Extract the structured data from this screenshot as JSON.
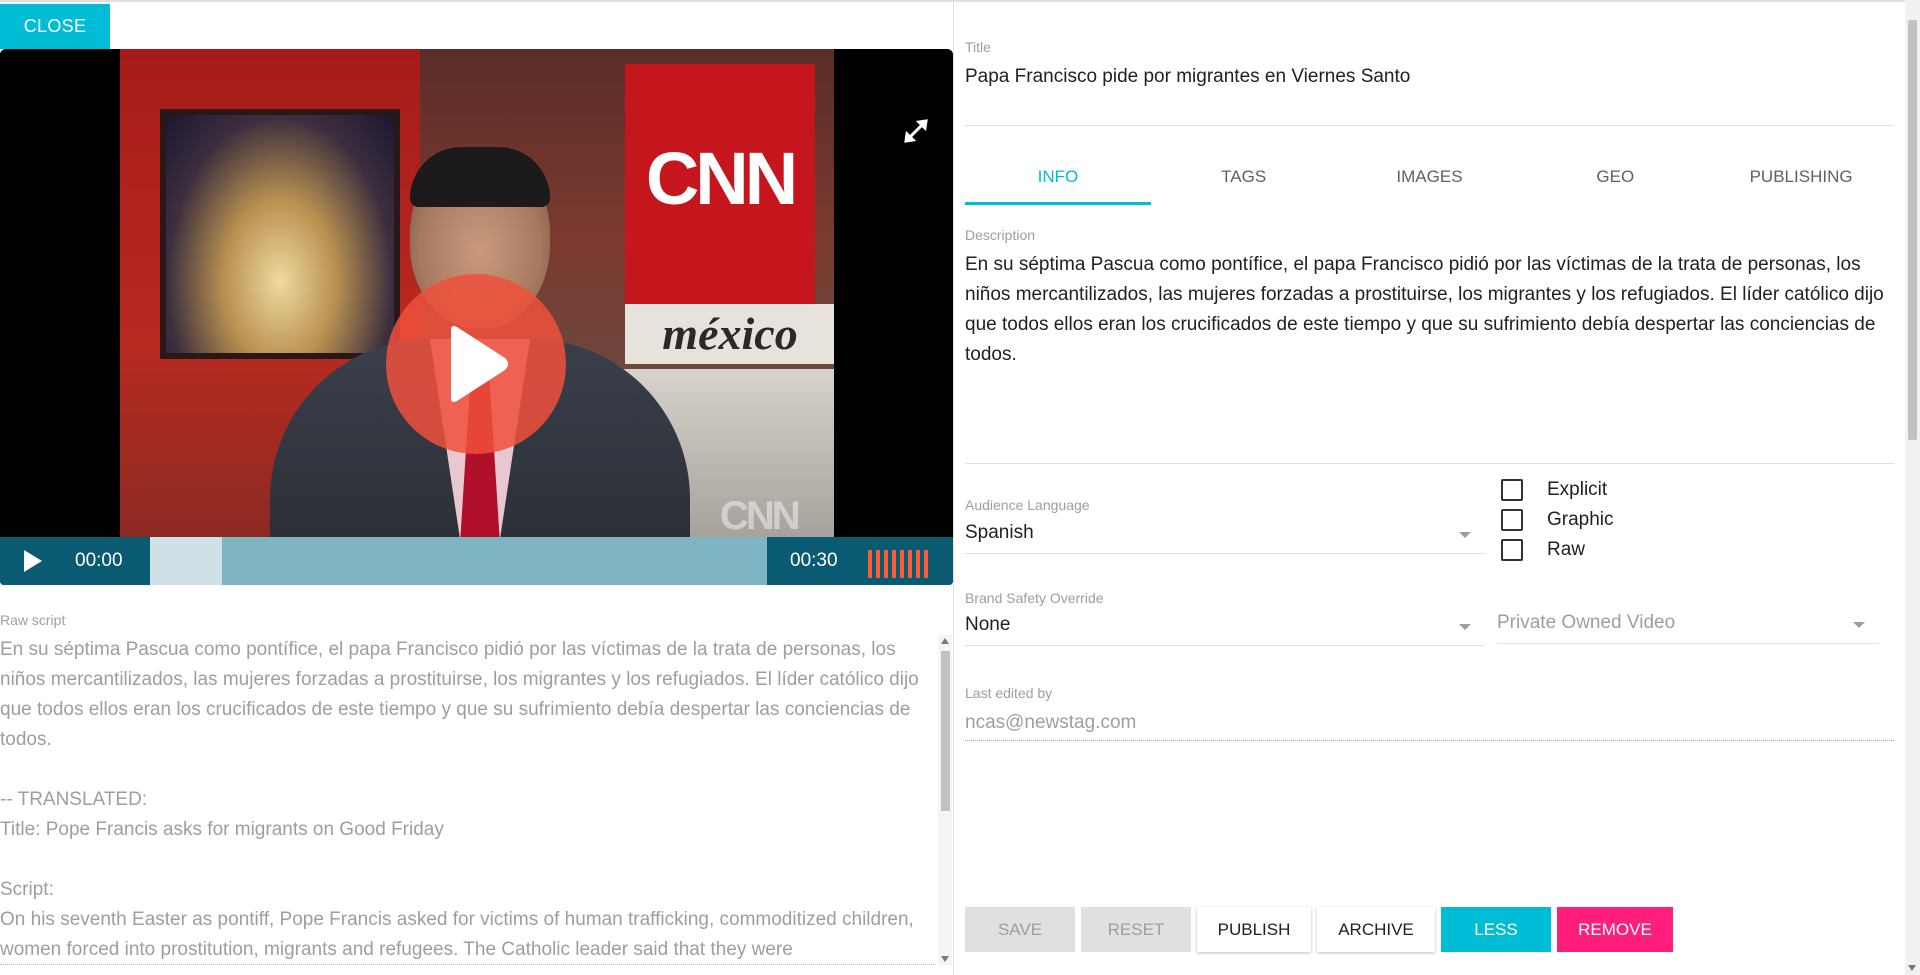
{
  "header": {
    "close_label": "CLOSE"
  },
  "player": {
    "current_time": "00:00",
    "duration": "00:30",
    "progress": 0,
    "buffered": 0.117,
    "volume_bars": 8,
    "thumbnail": {
      "logo_text": "CNN",
      "sign_text": "méxico",
      "watermark": "CNN"
    }
  },
  "raw_script": {
    "label": "Raw script",
    "text": "En su séptima Pascua como pontífice, el papa Francisco pidió por las víctimas de la trata de personas, los niños mercantilizados, las mujeres forzadas a prostituirse, los migrantes y los refugiados. El líder católico dijo que todos ellos eran los crucificados de este tiempo y que su sufrimiento debía despertar las conciencias de todos.\n\n-- TRANSLATED:\nTitle: Pope Francis asks for migrants on Good Friday\n\nScript:\nOn his seventh Easter as pontiff, Pope Francis asked for victims of human trafficking, commoditized children, women forced into prostitution, migrants and refugees. The Catholic leader said that they were"
  },
  "form": {
    "title_label": "Title",
    "title_value": "Papa Francisco pide por migrantes en Viernes Santo",
    "tabs": [
      {
        "label": "INFO",
        "active": true
      },
      {
        "label": "TAGS",
        "active": false
      },
      {
        "label": "IMAGES",
        "active": false
      },
      {
        "label": "GEO",
        "active": false
      },
      {
        "label": "PUBLISHING",
        "active": false
      }
    ],
    "description_label": "Description",
    "description_value": "En su séptima Pascua como pontífice, el papa Francisco pidió por las víctimas de la trata de personas, los niños mercantilizados, las mujeres forzadas a prostituirse, los migrantes y los refugiados. El líder católico dijo que todos ellos eran los crucificados de este tiempo y que su sufrimiento debía despertar las conciencias de todos.",
    "audience_language_label": "Audience Language",
    "audience_language_value": "Spanish",
    "checkboxes": [
      {
        "label": "Explicit",
        "checked": false
      },
      {
        "label": "Graphic",
        "checked": false
      },
      {
        "label": "Raw",
        "checked": false
      }
    ],
    "brand_safety_label": "Brand Safety Override",
    "brand_safety_value": "None",
    "ownership_placeholder": "Private Owned Video",
    "last_edited_label": "Last edited by",
    "last_edited_value": "ncas@newstag.com"
  },
  "actions": {
    "save": "SAVE",
    "reset": "RESET",
    "publish": "PUBLISH",
    "archive": "ARCHIVE",
    "less": "LESS",
    "remove": "REMOVE"
  },
  "colors": {
    "accent": "#00bcd4",
    "danger": "#ff1f7a",
    "player_bar": "#0a5a72",
    "play_button": "#f0503c"
  }
}
